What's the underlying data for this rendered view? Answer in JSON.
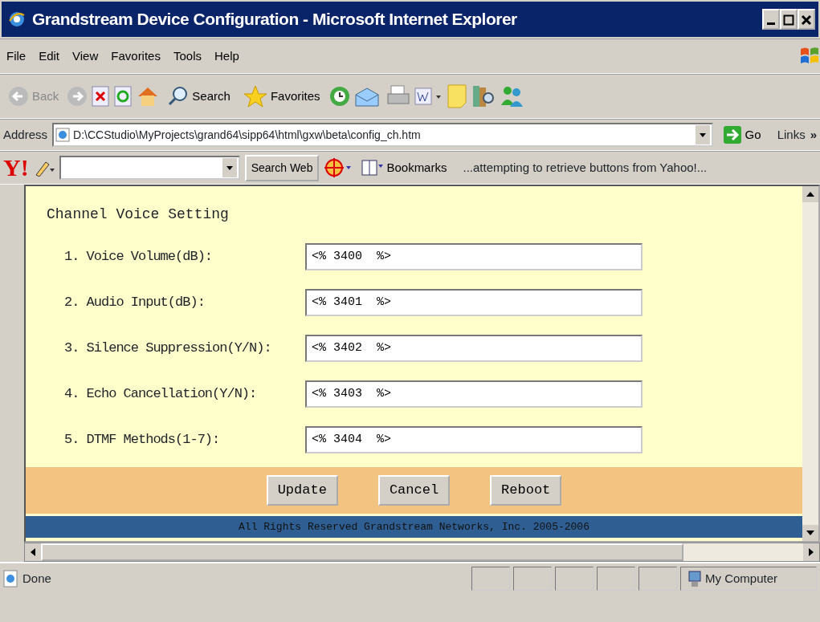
{
  "window": {
    "title": "Grandstream Device Configuration - Microsoft Internet Explorer"
  },
  "menu": [
    "File",
    "Edit",
    "View",
    "Favorites",
    "Tools",
    "Help"
  ],
  "toolbar": {
    "back": "Back",
    "search": "Search",
    "favorites": "Favorites"
  },
  "address_bar": {
    "label": "Address",
    "url": "D:\\CCStudio\\MyProjects\\grand64\\sipp64\\html\\gxw\\beta\\config_ch.htm",
    "go": "Go",
    "links": "Links",
    "links_more": "»"
  },
  "yahoo_bar": {
    "logo": "Y!",
    "search_button": "Search Web",
    "bookmarks": "Bookmarks",
    "message": "...attempting to retrieve buttons from Yahoo!..."
  },
  "form": {
    "title": "Channel Voice Setting",
    "fields": [
      {
        "label": "1. Voice Volume(dB):",
        "value": "<% 3400  %>"
      },
      {
        "label": "2. Audio Input(dB):",
        "value": "<% 3401  %>"
      },
      {
        "label": "3. Silence Suppression(Y/N):",
        "value": "<% 3402  %>"
      },
      {
        "label": "4. Echo Cancellation(Y/N):",
        "value": "<% 3403  %>"
      },
      {
        "label": "5. DTMF Methods(1-7):",
        "value": "<% 3404  %>"
      }
    ],
    "buttons": [
      "Update",
      "Cancel",
      "Reboot"
    ],
    "footer": "All Rights Reserved Grandstream Networks, Inc. 2005-2006"
  },
  "status_bar": {
    "text": "Done",
    "zone": "My Computer"
  }
}
